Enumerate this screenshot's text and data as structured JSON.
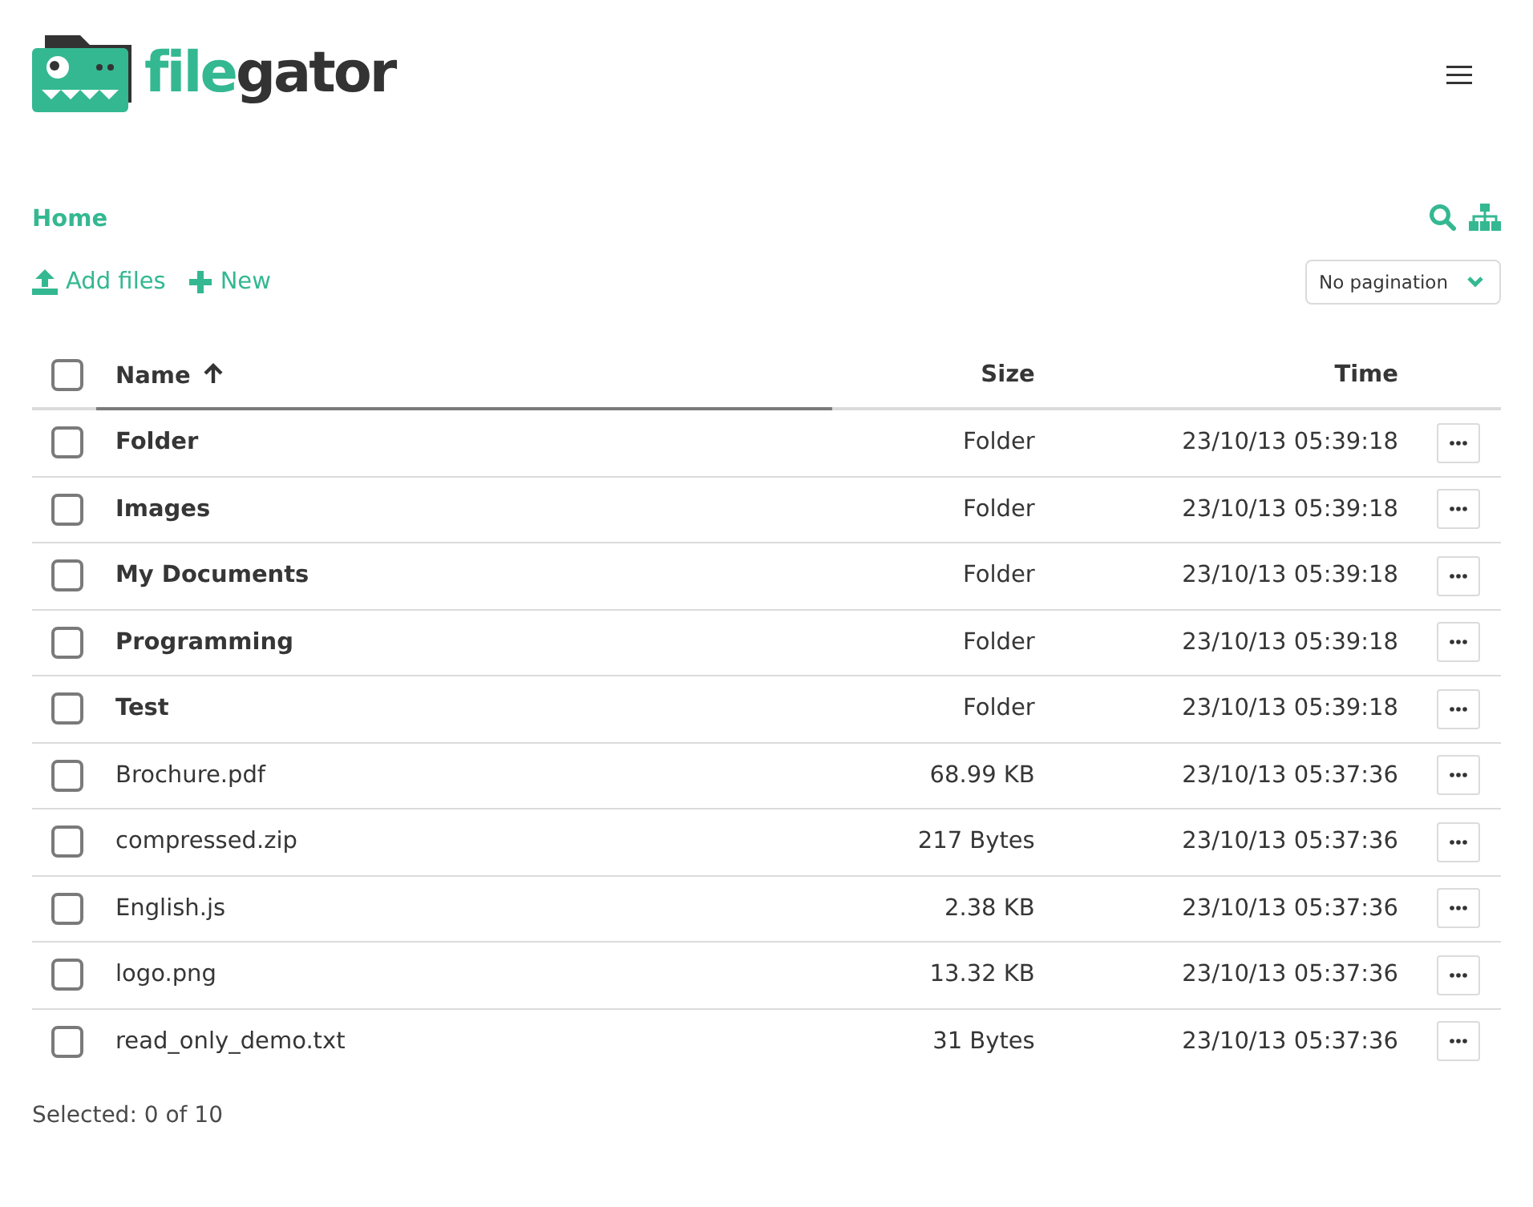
{
  "logo": {
    "first": "file",
    "second": "gator"
  },
  "breadcrumb": [
    {
      "label": "Home"
    }
  ],
  "actions": [
    {
      "kind": "upload",
      "label": "Add files"
    },
    {
      "kind": "new",
      "label": "New"
    }
  ],
  "pagination": {
    "value": "No pagination"
  },
  "table": {
    "select_all": {
      "checked": false
    },
    "columns": [
      {
        "label": "Name",
        "sorted": true
      },
      {
        "label": "Size",
        "sorted": false
      },
      {
        "label": "Time",
        "sorted": false
      }
    ],
    "rows": [
      {
        "kind": "folder",
        "name": "Folder",
        "size": "Folder",
        "time": "23/10/13 05:39:18",
        "checked": false
      },
      {
        "kind": "folder",
        "name": "Images",
        "size": "Folder",
        "time": "23/10/13 05:39:18",
        "checked": false
      },
      {
        "kind": "folder",
        "name": "My Documents",
        "size": "Folder",
        "time": "23/10/13 05:39:18",
        "checked": false
      },
      {
        "kind": "folder",
        "name": "Programming",
        "size": "Folder",
        "time": "23/10/13 05:39:18",
        "checked": false
      },
      {
        "kind": "folder",
        "name": "Test",
        "size": "Folder",
        "time": "23/10/13 05:39:18",
        "checked": false
      },
      {
        "kind": "file",
        "name": "Brochure.pdf",
        "size": "68.99 KB",
        "time": "23/10/13 05:37:36",
        "checked": false
      },
      {
        "kind": "file",
        "name": "compressed.zip",
        "size": "217 Bytes",
        "time": "23/10/13 05:37:36",
        "checked": false
      },
      {
        "kind": "file",
        "name": "English.js",
        "size": "2.38 KB",
        "time": "23/10/13 05:37:36",
        "checked": false
      },
      {
        "kind": "file",
        "name": "logo.png",
        "size": "13.32 KB",
        "time": "23/10/13 05:37:36",
        "checked": false
      },
      {
        "kind": "file",
        "name": "read_only_demo.txt",
        "size": "31 Bytes",
        "time": "23/10/13 05:37:36",
        "checked": false
      }
    ]
  },
  "status": "Selected: 0 of 10"
}
